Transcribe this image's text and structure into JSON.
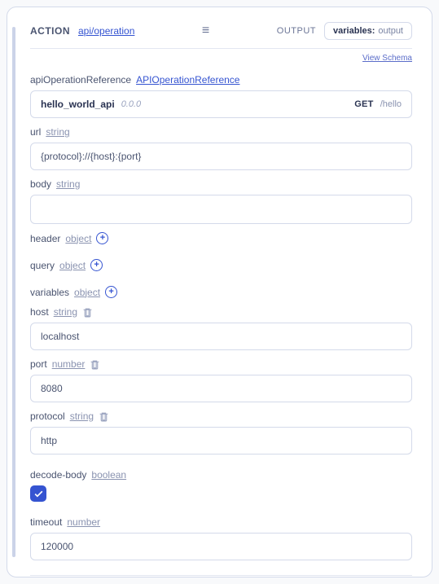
{
  "header": {
    "action_label": "ACTION",
    "action_link": "api/operation",
    "output_label": "OUTPUT",
    "output_key": "variables:",
    "output_value": "output",
    "view_schema": "View Schema"
  },
  "apiRef": {
    "label": "apiOperationReference",
    "type": "APIOperationReference",
    "name": "hello_world_api",
    "version": "0.0.0",
    "method": "GET",
    "path": "/hello"
  },
  "url": {
    "label": "url",
    "type": "string",
    "value": "{protocol}://{host}:{port}"
  },
  "body": {
    "label": "body",
    "type": "string",
    "value": ""
  },
  "headerField": {
    "label": "header",
    "type": "object"
  },
  "query": {
    "label": "query",
    "type": "object"
  },
  "variables": {
    "label": "variables",
    "type": "object"
  },
  "host": {
    "label": "host",
    "type": "string",
    "value": "localhost"
  },
  "port": {
    "label": "port",
    "type": "number",
    "value": "8080"
  },
  "protocol": {
    "label": "protocol",
    "type": "string",
    "value": "http"
  },
  "decodeBody": {
    "label": "decode-body",
    "type": "boolean",
    "checked": true
  },
  "timeout": {
    "label": "timeout",
    "type": "number",
    "value": "120000"
  }
}
